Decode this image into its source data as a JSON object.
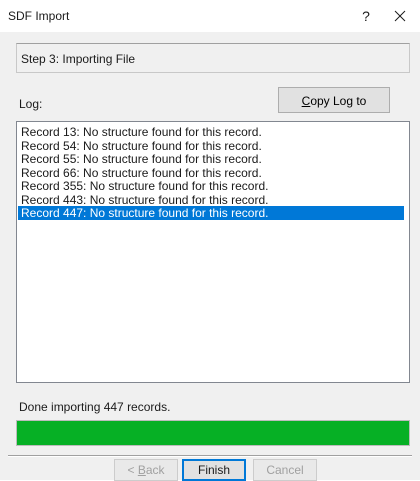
{
  "window": {
    "title": "SDF Import",
    "help_label": "?"
  },
  "step": {
    "text": "Step 3: Importing File"
  },
  "log": {
    "label": "Log:",
    "copy_button_prefix": "C",
    "copy_button_rest": "opy Log to Clipboard",
    "entries": [
      "Record 13: No structure found for this record.",
      "Record 54: No structure found for this record.",
      "Record 55: No structure found for this record.",
      "Record 66: No structure found for this record.",
      "Record 355: No structure found for this record.",
      "Record 443: No structure found for this record.",
      "Record 447: No structure found for this record."
    ],
    "selected_index": 6
  },
  "status": {
    "text": "Done importing 447 records.",
    "progress_percent": 100,
    "progress_color": "#06b025"
  },
  "buttons": {
    "back_prefix": "< ",
    "back_underlined": "B",
    "back_rest": "ack",
    "finish": "Finish",
    "cancel": "Cancel"
  },
  "colors": {
    "selection": "#0078d7"
  }
}
